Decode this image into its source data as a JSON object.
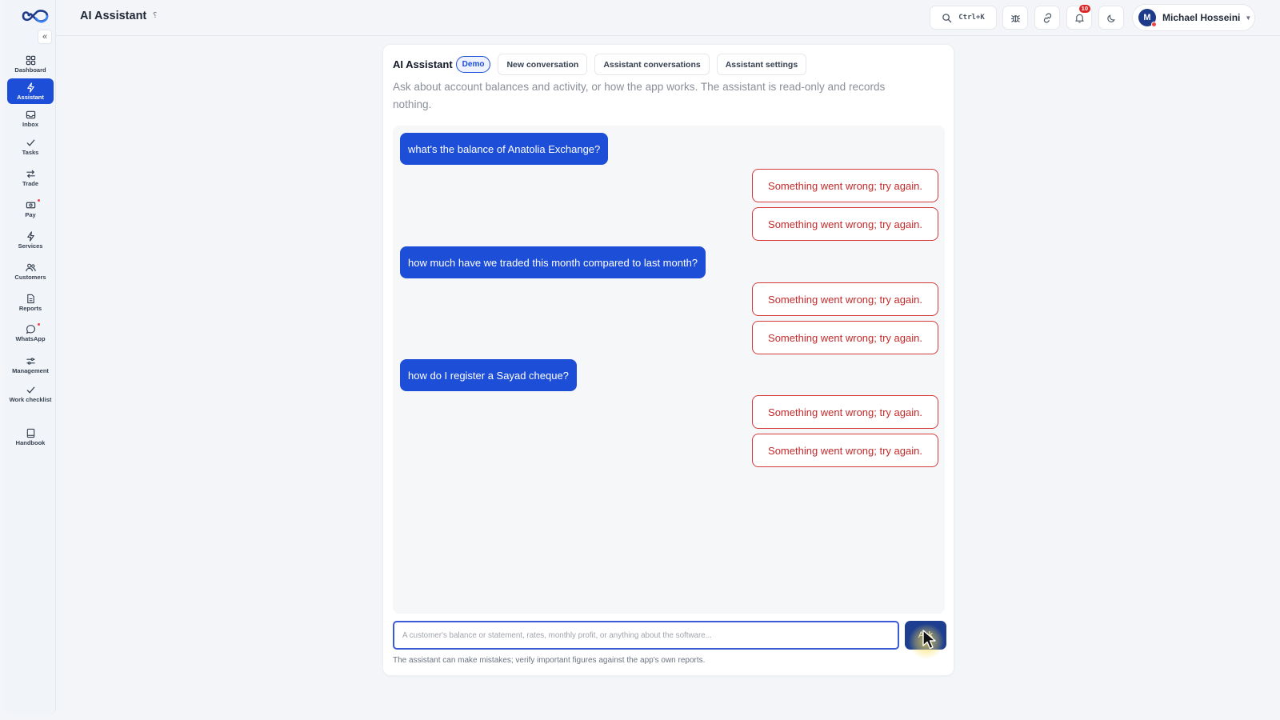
{
  "topbar": {
    "title": "AI Assistant",
    "search_shortcut": "Ctrl+K",
    "notification_count": "10",
    "user_initial": "M",
    "user_name": "Michael Hosseini"
  },
  "sidebar": {
    "items": [
      {
        "label": "Dashboard",
        "icon": "grid-icon"
      },
      {
        "label": "Assistant",
        "icon": "bolt-icon",
        "active": true
      },
      {
        "label": "Inbox",
        "icon": "inbox-icon"
      },
      {
        "label": "Tasks",
        "icon": "check-icon"
      },
      {
        "label": "Trade",
        "icon": "arrows-icon"
      },
      {
        "label": "Pay",
        "icon": "money-icon"
      },
      {
        "label": "Services",
        "icon": "bolt-icon"
      },
      {
        "label": "Customers",
        "icon": "users-icon"
      },
      {
        "label": "Reports",
        "icon": "document-icon"
      },
      {
        "label": "WhatsApp",
        "icon": "chat-bubble-icon"
      },
      {
        "label": "Management",
        "icon": "sliders-icon"
      },
      {
        "label": "Work checklist",
        "icon": "check-icon"
      },
      {
        "label": "Handbook",
        "icon": "book-icon"
      }
    ]
  },
  "card": {
    "title": "AI Assistant",
    "badge": "Demo",
    "tabs": [
      "New conversation",
      "Assistant conversations",
      "Assistant settings"
    ],
    "description": "Ask about account balances and activity, or how the app works. The assistant is read-only and records nothing."
  },
  "messages": [
    {
      "role": "user",
      "text": "what's the balance of Anatolia Exchange?"
    },
    {
      "role": "error",
      "text": "Something went wrong; try again."
    },
    {
      "role": "error",
      "text": "Something went wrong; try again."
    },
    {
      "role": "user",
      "text": "how much have we traded this month compared to last month?"
    },
    {
      "role": "error",
      "text": "Something went wrong; try again."
    },
    {
      "role": "error",
      "text": "Something went wrong; try again."
    },
    {
      "role": "user",
      "text": "how do I register a Sayad cheque?"
    },
    {
      "role": "error",
      "text": "Something went wrong; try again."
    },
    {
      "role": "error",
      "text": "Something went wrong; try again."
    }
  ],
  "composer": {
    "placeholder": "A customer's balance or statement, rates, monthly profit, or anything about the software...",
    "value": "",
    "ask_label": "Ask",
    "disclaimer": "The assistant can make mistakes; verify important figures against the app's own reports."
  },
  "colors": {
    "accent": "#1d4ed8",
    "error": "#c52a2a",
    "ask_button": "#1e3f8f"
  }
}
